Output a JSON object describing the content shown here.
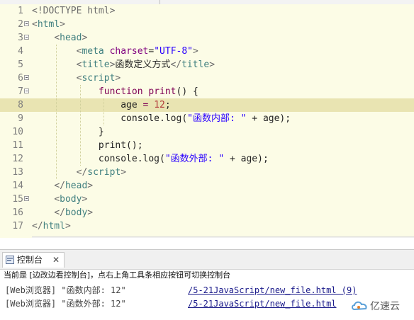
{
  "editor": {
    "lines": [
      {
        "num": "1",
        "parts": [
          [
            "g",
            "<!DOCTYPE html>"
          ]
        ]
      },
      {
        "num": "2",
        "parts": [
          [
            "g",
            "<"
          ],
          [
            "t",
            "html"
          ],
          [
            "g",
            ">"
          ]
        ]
      },
      {
        "num": "3",
        "parts": [
          [
            "n",
            "    "
          ],
          [
            "g",
            "<"
          ],
          [
            "t",
            "head"
          ],
          [
            "g",
            ">"
          ]
        ]
      },
      {
        "num": "4",
        "parts": [
          [
            "n",
            "        "
          ],
          [
            "g",
            "<"
          ],
          [
            "t",
            "meta"
          ],
          [
            "n",
            " "
          ],
          [
            "a",
            "charset"
          ],
          [
            "n",
            "="
          ],
          [
            "s",
            "\"UTF-8\""
          ],
          [
            "g",
            ">"
          ]
        ]
      },
      {
        "num": "5",
        "parts": [
          [
            "n",
            "        "
          ],
          [
            "g",
            "<"
          ],
          [
            "t",
            "title"
          ],
          [
            "g",
            ">"
          ],
          [
            "n",
            "函数定义方式"
          ],
          [
            "g",
            "</"
          ],
          [
            "t",
            "title"
          ],
          [
            "g",
            ">"
          ]
        ]
      },
      {
        "num": "6",
        "parts": [
          [
            "n",
            "        "
          ],
          [
            "g",
            "<"
          ],
          [
            "t",
            "script"
          ],
          [
            "g",
            ">"
          ]
        ]
      },
      {
        "num": "7",
        "parts": [
          [
            "n",
            "            "
          ],
          [
            "k",
            "function"
          ],
          [
            "n",
            " "
          ],
          [
            "fn",
            "print"
          ],
          [
            "n",
            "() {"
          ]
        ]
      },
      {
        "num": "8",
        "parts": [
          [
            "n",
            "                age "
          ],
          [
            "k",
            "="
          ],
          [
            "n",
            " "
          ],
          [
            "num",
            "12"
          ],
          [
            "n",
            ";"
          ]
        ]
      },
      {
        "num": "9",
        "parts": [
          [
            "n",
            "                console.log("
          ],
          [
            "s",
            "\"函数内部: \""
          ],
          [
            "n",
            " + age);"
          ]
        ]
      },
      {
        "num": "10",
        "parts": [
          [
            "n",
            "            }"
          ]
        ]
      },
      {
        "num": "11",
        "parts": [
          [
            "n",
            "            print();"
          ]
        ]
      },
      {
        "num": "12",
        "parts": [
          [
            "n",
            "            console.log("
          ],
          [
            "s",
            "\"函数外部: \""
          ],
          [
            "n",
            " + age);"
          ]
        ]
      },
      {
        "num": "13",
        "parts": [
          [
            "n",
            "        "
          ],
          [
            "g",
            "</"
          ],
          [
            "t",
            "script"
          ],
          [
            "g",
            ">"
          ]
        ]
      },
      {
        "num": "14",
        "parts": [
          [
            "n",
            "    "
          ],
          [
            "g",
            "</"
          ],
          [
            "t",
            "head"
          ],
          [
            "g",
            ">"
          ]
        ]
      },
      {
        "num": "15",
        "parts": [
          [
            "n",
            "    "
          ],
          [
            "g",
            "<"
          ],
          [
            "t",
            "body"
          ],
          [
            "g",
            ">"
          ]
        ]
      },
      {
        "num": "16",
        "parts": [
          [
            "n",
            "    "
          ],
          [
            "g",
            "</"
          ],
          [
            "t",
            "body"
          ],
          [
            "g",
            ">"
          ]
        ]
      },
      {
        "num": "17",
        "parts": [
          [
            "g",
            "</"
          ],
          [
            "t",
            "html"
          ],
          [
            "g",
            ">"
          ]
        ]
      }
    ],
    "highlighted_line": "8",
    "fold_lines": [
      "2",
      "3",
      "6",
      "7",
      "15"
    ]
  },
  "console": {
    "tab_label": "控制台",
    "tab_close": "✕",
    "status_text": "当前是 [边改边看控制台]，点右上角工具条相应按钮可切换控制台",
    "output": [
      {
        "text": "[Web浏览器] \"函数内部: 12\"",
        "link": "/5-21JavaScript/new_file.html (9)"
      },
      {
        "text": "[Web浏览器] \"函数外部: 12\"",
        "link": "/5-21JavaScript/new_file.html"
      }
    ]
  },
  "watermark": {
    "text": "亿速云",
    "icon": "cloud-logo-icon"
  },
  "colors": {
    "editor_bg": "#fcfce6",
    "highlight": "#e9e4b2",
    "tag": "#3f7f7f",
    "attr": "#7f007f",
    "string": "#2a00ff",
    "keyword": "#7f0055"
  }
}
